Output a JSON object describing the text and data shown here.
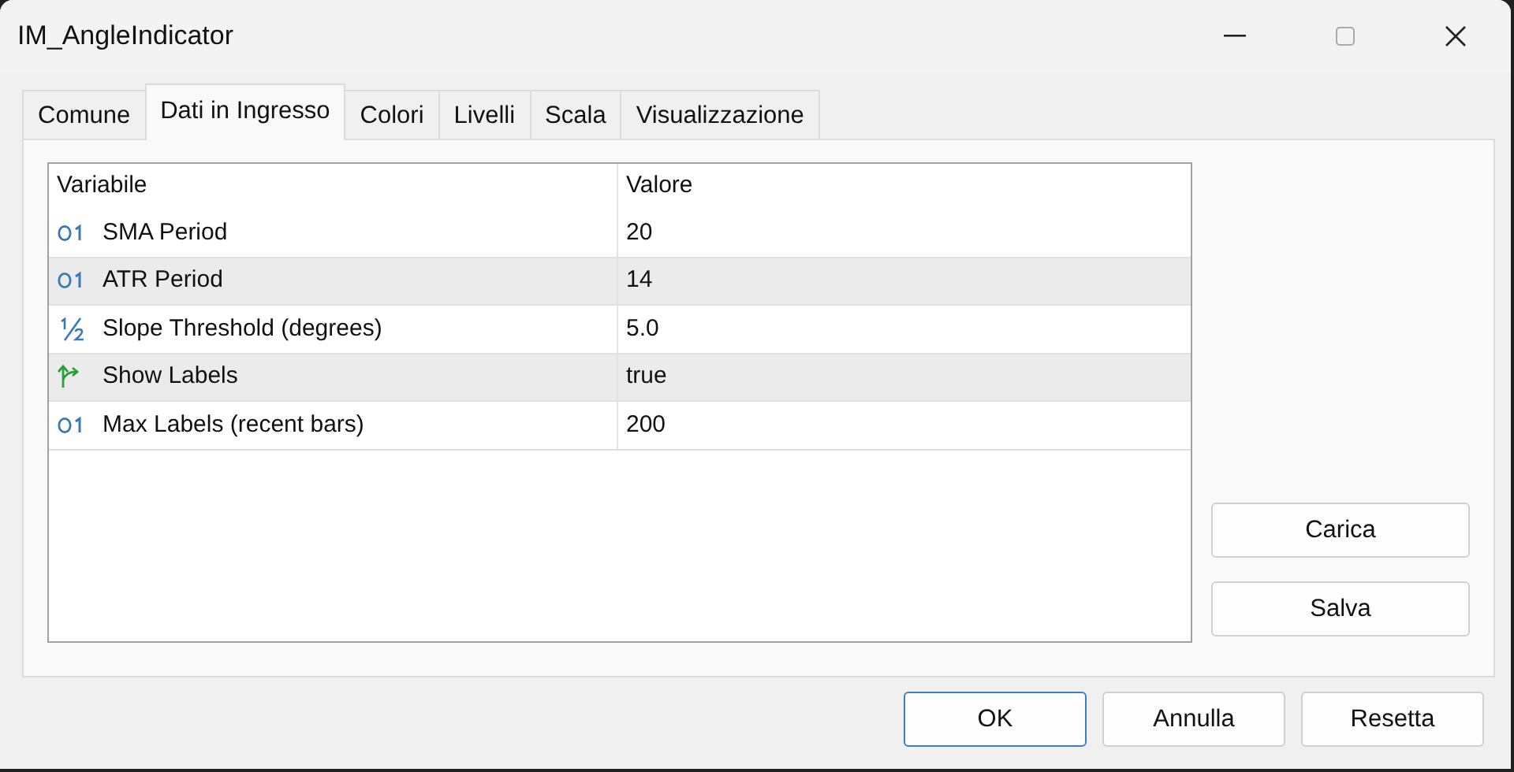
{
  "window": {
    "title": "IM_AngleIndicator"
  },
  "tabs": [
    {
      "label": "Comune",
      "selected": false
    },
    {
      "label": "Dati in Ingresso",
      "selected": true
    },
    {
      "label": "Colori",
      "selected": false
    },
    {
      "label": "Livelli",
      "selected": false
    },
    {
      "label": "Scala",
      "selected": false
    },
    {
      "label": "Visualizzazione",
      "selected": false
    }
  ],
  "table": {
    "columns": [
      "Variabile",
      "Valore"
    ],
    "rows": [
      {
        "kind": "integer",
        "name": "SMA Period",
        "value": "20"
      },
      {
        "kind": "integer",
        "name": "ATR Period",
        "value": "14"
      },
      {
        "kind": "fraction",
        "name": "Slope Threshold (degrees)",
        "value": "5.0"
      },
      {
        "kind": "boolean",
        "name": "Show Labels",
        "value": "true"
      },
      {
        "kind": "integer",
        "name": "Max Labels (recent bars)",
        "value": "200"
      }
    ]
  },
  "side_buttons": [
    "Carica",
    "Salva"
  ],
  "buttons": [
    {
      "label": "OK",
      "focused": true
    },
    {
      "label": "Annulla",
      "focused": false
    },
    {
      "label": "Resetta",
      "focused": false
    }
  ]
}
